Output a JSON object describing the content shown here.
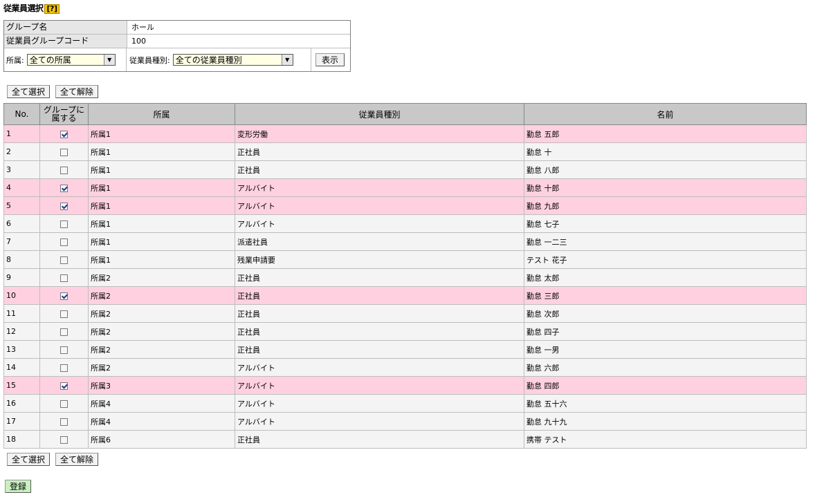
{
  "page": {
    "title": "従業員選択",
    "help": "?"
  },
  "info": {
    "group_name_label": "グループ名",
    "group_name_value": "ホール",
    "group_code_label": "従業員グループコード",
    "group_code_value": "100",
    "affiliation_label": "所属:",
    "affiliation_selected": "全ての所属",
    "emp_type_label": "従業員種別:",
    "emp_type_selected": "全ての従業員種別",
    "show_button": "表示"
  },
  "actions": {
    "select_all": "全て選択",
    "clear_all": "全て解除",
    "register": "登録"
  },
  "table": {
    "headers": {
      "no": "No.",
      "member": "グループに属する",
      "affiliation": "所属",
      "emp_type": "従業員種別",
      "name": "名前"
    },
    "rows": [
      {
        "no": "1",
        "checked": true,
        "affiliation": "所属1",
        "emp_type": "変形労働",
        "name": "勤怠 五郎"
      },
      {
        "no": "2",
        "checked": false,
        "affiliation": "所属1",
        "emp_type": "正社員",
        "name": "勤怠 十"
      },
      {
        "no": "3",
        "checked": false,
        "affiliation": "所属1",
        "emp_type": "正社員",
        "name": "勤怠 八郎"
      },
      {
        "no": "4",
        "checked": true,
        "affiliation": "所属1",
        "emp_type": "アルバイト",
        "name": "勤怠 十郎"
      },
      {
        "no": "5",
        "checked": true,
        "affiliation": "所属1",
        "emp_type": "アルバイト",
        "name": "勤怠 九郎"
      },
      {
        "no": "6",
        "checked": false,
        "affiliation": "所属1",
        "emp_type": "アルバイト",
        "name": "勤怠 七子"
      },
      {
        "no": "7",
        "checked": false,
        "affiliation": "所属1",
        "emp_type": "派遣社員",
        "name": "勤怠 一二三"
      },
      {
        "no": "8",
        "checked": false,
        "affiliation": "所属1",
        "emp_type": "残業申請要",
        "name": "テスト 花子"
      },
      {
        "no": "9",
        "checked": false,
        "affiliation": "所属2",
        "emp_type": "正社員",
        "name": "勤怠 太郎"
      },
      {
        "no": "10",
        "checked": true,
        "affiliation": "所属2",
        "emp_type": "正社員",
        "name": "勤怠 三郎"
      },
      {
        "no": "11",
        "checked": false,
        "affiliation": "所属2",
        "emp_type": "正社員",
        "name": "勤怠 次郎"
      },
      {
        "no": "12",
        "checked": false,
        "affiliation": "所属2",
        "emp_type": "正社員",
        "name": "勤怠 四子"
      },
      {
        "no": "13",
        "checked": false,
        "affiliation": "所属2",
        "emp_type": "正社員",
        "name": "勤怠 一男"
      },
      {
        "no": "14",
        "checked": false,
        "affiliation": "所属2",
        "emp_type": "アルバイト",
        "name": "勤怠 六郎"
      },
      {
        "no": "15",
        "checked": true,
        "affiliation": "所属3",
        "emp_type": "アルバイト",
        "name": "勤怠 四郎"
      },
      {
        "no": "16",
        "checked": false,
        "affiliation": "所属4",
        "emp_type": "アルバイト",
        "name": "勤怠 五十六"
      },
      {
        "no": "17",
        "checked": false,
        "affiliation": "所属4",
        "emp_type": "アルバイト",
        "name": "勤怠 九十九"
      },
      {
        "no": "18",
        "checked": false,
        "affiliation": "所属6",
        "emp_type": "正社員",
        "name": "携帯 テスト"
      }
    ]
  },
  "colors": {
    "selected_row": "#ffd1e0",
    "header": "#c8c8c8",
    "help_badge": "#f5c400",
    "register_button": "#c8f0c0"
  }
}
